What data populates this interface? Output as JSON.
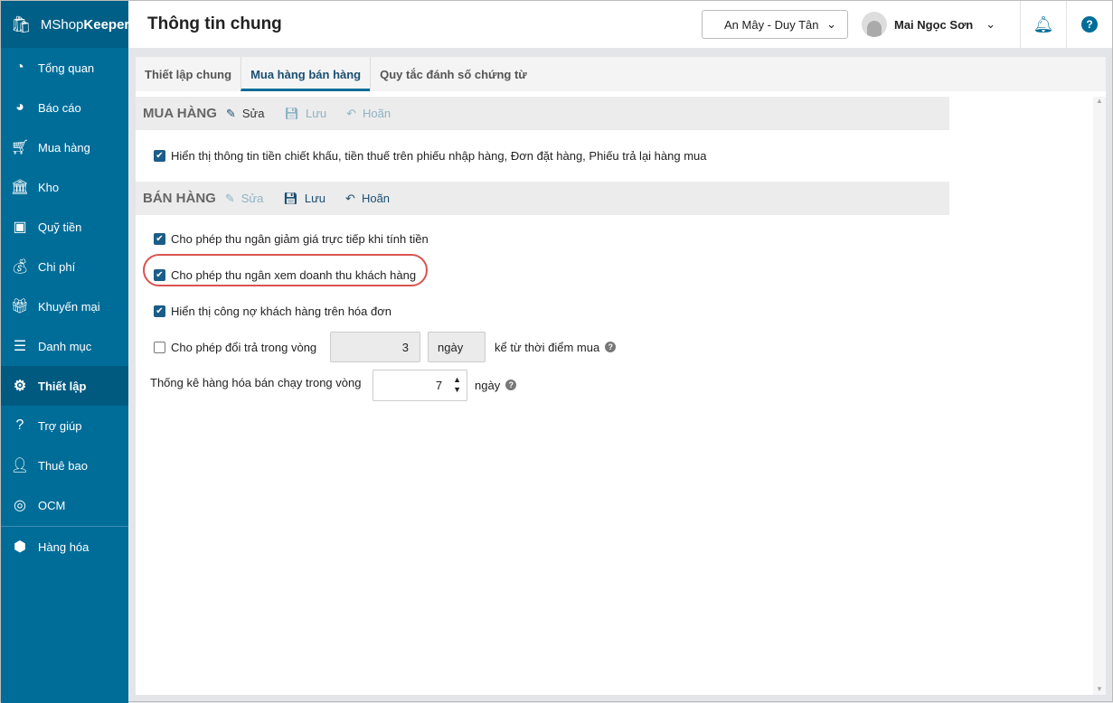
{
  "app": {
    "logo_light": "MShop",
    "logo_bold": "Keeper"
  },
  "sidebar": {
    "items": [
      {
        "label": "Tổng quan",
        "icon": "dashboard-icon"
      },
      {
        "label": "Báo cáo",
        "icon": "pie-chart-icon"
      },
      {
        "label": "Mua hàng",
        "icon": "cart-icon"
      },
      {
        "label": "Kho",
        "icon": "warehouse-icon"
      },
      {
        "label": "Quỹ tiền",
        "icon": "safe-icon"
      },
      {
        "label": "Chi phí",
        "icon": "money-bag-icon"
      },
      {
        "label": "Khuyến mại",
        "icon": "gift-icon"
      },
      {
        "label": "Danh mục",
        "icon": "list-icon"
      },
      {
        "label": "Thiết lập",
        "icon": "gear-icon",
        "active": true
      },
      {
        "label": "Trợ giúp",
        "icon": "help-icon"
      },
      {
        "label": "Thuê bao",
        "icon": "user-icon"
      },
      {
        "label": "OCM",
        "icon": "ocm-icon"
      },
      {
        "label": "Hàng hóa",
        "icon": "boxes-icon"
      }
    ]
  },
  "header": {
    "title": "Thông tin chung",
    "store": "An Mây - Duy Tân",
    "user": "Mai Ngọc Sơn"
  },
  "tabs": [
    {
      "label": "Thiết lập chung"
    },
    {
      "label": "Mua hàng bán hàng",
      "active": true
    },
    {
      "label": "Quy tắc đánh số chứng từ"
    }
  ],
  "purchase": {
    "title": "MUA HÀNG",
    "edit": "Sửa",
    "save": "Lưu",
    "cancel": "Hoãn",
    "options": [
      {
        "label": "Hiển thị thông tin tiền chiết khấu, tiền thuế trên phiếu nhập hàng, Đơn đặt hàng, Phiếu trả lại hàng mua",
        "checked": true
      }
    ]
  },
  "sales": {
    "title": "BÁN HÀNG",
    "edit": "Sửa",
    "save": "Lưu",
    "cancel": "Hoãn",
    "options": [
      {
        "label": "Cho phép thu ngân giảm giá trực tiếp khi tính tiền",
        "checked": true
      },
      {
        "label": "Cho phép thu ngân xem doanh thu khách hàng",
        "checked": true,
        "highlighted": true
      },
      {
        "label": "Hiển thị công nợ khách hàng trên hóa đơn",
        "checked": true
      },
      {
        "label": "Cho phép đổi trả trong vòng",
        "checked": false,
        "value": "3",
        "unit": "ngày",
        "suffix": "kể từ thời điểm mua"
      }
    ],
    "bestseller": {
      "label": "Thống kê hàng hóa bán chạy trong vòng",
      "value": "7",
      "unit": "ngày"
    }
  },
  "colors": {
    "sidebar": "#006d99",
    "accent": "#1b5d88",
    "highlight": "#d9534f"
  }
}
